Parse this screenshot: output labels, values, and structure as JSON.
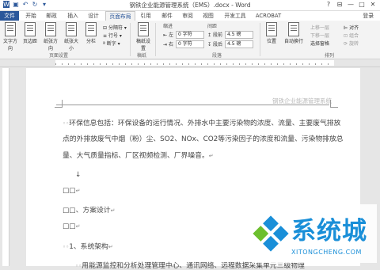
{
  "window": {
    "title": "钢铁企业能源管理系统（EMS）.docx - Word",
    "minimize": "—",
    "maximize": "□",
    "close": "✕",
    "help": "?"
  },
  "tabs": [
    {
      "label": "文件"
    },
    {
      "label": "开始"
    },
    {
      "label": "邮政"
    },
    {
      "label": "插入"
    },
    {
      "label": "设计"
    },
    {
      "label": "页面布局"
    },
    {
      "label": "引用"
    },
    {
      "label": "邮件"
    },
    {
      "label": "审阅"
    },
    {
      "label": "视图"
    },
    {
      "label": "开发工具"
    },
    {
      "label": "ACROBAT"
    }
  ],
  "active_tab": "页面布局",
  "login": "登录",
  "ribbon": {
    "page_setup": {
      "buttons": [
        "文字方向",
        "页边距",
        "纸张方向",
        "纸张大小",
        "分栏"
      ],
      "small": [
        "分隔符",
        "行号",
        "断字"
      ],
      "group_label": "页面设置"
    },
    "manuscript": {
      "button": "稿纸设置",
      "group_label": "稿纸"
    },
    "paragraph": {
      "indent_title": "缩进",
      "spacing_title": "间距",
      "left_label": "左",
      "right_label": "右",
      "before_label": "段前",
      "after_label": "段后",
      "left_value": "0 字符",
      "right_value": "0 字符",
      "before_value": "4.5 磅",
      "after_value": "4.5 磅",
      "group_label": "段落"
    },
    "arrange": {
      "buttons": [
        "位置",
        "自动换行"
      ],
      "small": [
        "上移一层",
        "下移一层",
        "选择窗格",
        "对齐",
        "组合",
        "旋转"
      ],
      "group_label": "排列"
    }
  },
  "document": {
    "header_text": "钢铁企业能源管理系统",
    "paragraphs": [
      "环保信息包括：环保设备的运行情况、外排水中主要污染物的浓度、流量、主要废气排放",
      "点的外排放废气中烟（粉）尘、SO2、NOx、CO2等污染因子的浓度和流量、污染物排放总",
      "量、大气质量指标、厂区视频检测、厂界噪音。"
    ],
    "blank_mark": "↓",
    "items": [
      "□□",
      "□□、方案设计",
      "□□",
      "1、系统架构",
      "用能源监控和分析处理管理中心、通讯网络、远程数据采集单元三级物理"
    ],
    "para_mark": "↵"
  },
  "watermark": {
    "site": "系统城",
    "url": "XITONGCHENG.COM",
    "colors": {
      "blue": "#1a8fd8",
      "green": "#6cbf2e"
    }
  }
}
